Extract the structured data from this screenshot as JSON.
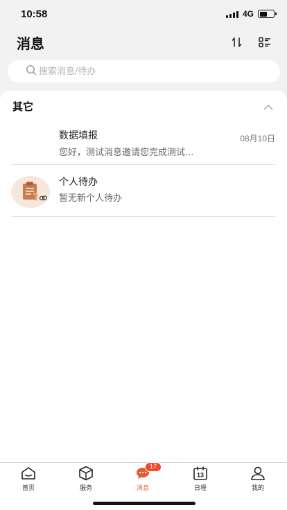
{
  "status_bar": {
    "time": "10:58",
    "network": "4G",
    "battery_level": 0.55
  },
  "header": {
    "title": "消息",
    "sort_icon": "sort-icon",
    "list_icon": "list-view-icon"
  },
  "search": {
    "placeholder": "搜索消息/待办",
    "value": ""
  },
  "section": {
    "title": "其它",
    "collapse_icon": "chevron-up-icon"
  },
  "messages": [
    {
      "title": "数据填报",
      "preview": "您好，测试消息邀请您完成测试...",
      "date": "08月10日"
    },
    {
      "title": "个人待办",
      "preview": "暂无新个人待办",
      "icon": "clipboard-todo-icon"
    }
  ],
  "tabbar": {
    "active": "消息",
    "items": [
      {
        "label": "首页",
        "icon": "home-icon"
      },
      {
        "label": "服务",
        "icon": "cube-icon"
      },
      {
        "label": "消息",
        "icon": "chat-icon",
        "badge": "17"
      },
      {
        "label": "日程",
        "icon": "calendar-icon",
        "icon_text": "13"
      },
      {
        "label": "我的",
        "icon": "user-icon"
      }
    ]
  },
  "colors": {
    "accent": "#e8572f",
    "badge": "#ee4a2a",
    "background": "#f2f2f2"
  }
}
